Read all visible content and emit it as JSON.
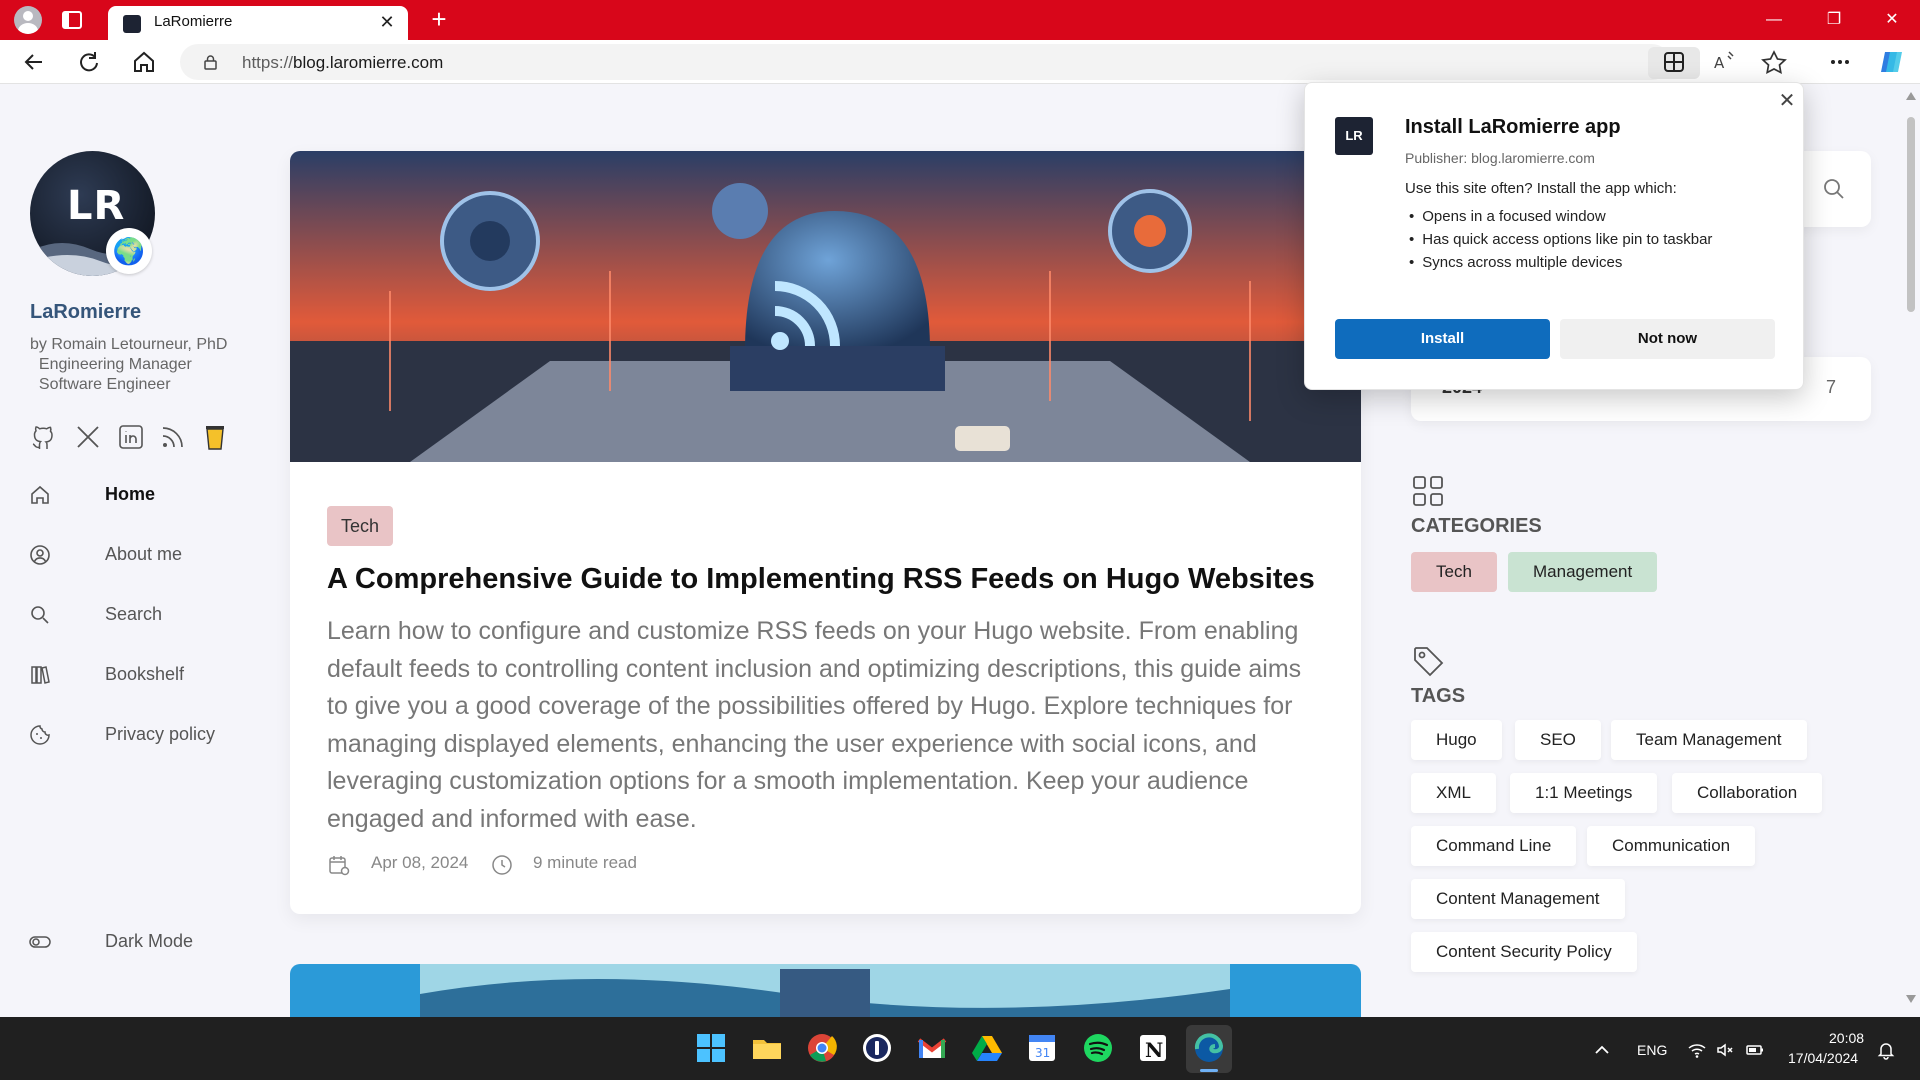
{
  "browser": {
    "tab_title": "LaRomierre",
    "url_protocol": "https://",
    "url_domain": "blog.laromierre.com"
  },
  "sidebar": {
    "avatar_mark": "LR",
    "badge_emoji": "🌍",
    "site_name": "LaRomierre",
    "bio": [
      "by Romain Letourneur, PhD",
      "  Engineering Manager",
      "  Software Engineer"
    ],
    "social_icons": [
      "github-icon",
      "x-icon",
      "linkedin-icon",
      "rss-icon",
      "coffee-icon"
    ],
    "menu": [
      {
        "label": "Home",
        "icon": "home-icon",
        "active": true
      },
      {
        "label": "About me",
        "icon": "user-circle-icon"
      },
      {
        "label": "Search",
        "icon": "search-icon"
      },
      {
        "label": "Bookshelf",
        "icon": "books-icon"
      },
      {
        "label": "Privacy policy",
        "icon": "cookie-icon"
      }
    ],
    "dark_mode_label": "Dark Mode"
  },
  "article": {
    "category": "Tech",
    "title": "A Comprehensive Guide to Implementing RSS Feeds on Hugo Websites",
    "description": "Learn how to configure and customize RSS feeds on your Hugo website. From enabling default feeds to controlling content inclusion and optimizing descriptions, this guide aims to give you a good coverage of the possibilities offered by Hugo. Explore techniques for managing displayed elements, enhancing the user experience with social icons, and leveraging customization options for a smooth implementation. Keep your audience engaged and informed with ease.",
    "date": "Apr 08, 2024",
    "read_time": "9 minute read"
  },
  "right_sidebar": {
    "archive": {
      "year": "2024",
      "count": "7"
    },
    "categories_title": "CATEGORIES",
    "categories": [
      "Tech",
      "Management"
    ],
    "tags_title": "TAGS",
    "tags": [
      "Hugo",
      "SEO",
      "Team Management",
      "XML",
      "1:1 Meetings",
      "Collaboration",
      "Command Line",
      "Communication",
      "Content Management",
      "Content Security Policy"
    ]
  },
  "install_popup": {
    "logo_mark": "LR",
    "title": "Install LaRomierre app",
    "publisher": "Publisher: blog.laromierre.com",
    "question": "Use this site often? Install the app which:",
    "bullets": [
      "Opens in a focused window",
      "Has quick access options like pin to taskbar",
      "Syncs across multiple devices"
    ],
    "install_label": "Install",
    "not_now_label": "Not now"
  },
  "taskbar": {
    "language": "ENG",
    "time": "20:08",
    "date": "17/04/2024",
    "apps": [
      "windows-start-icon",
      "file-explorer-icon",
      "chrome-icon",
      "1password-icon",
      "gmail-icon",
      "google-drive-icon",
      "google-calendar-icon",
      "spotify-icon",
      "notion-icon",
      "edge-icon"
    ]
  },
  "colors": {
    "titlebar": "#d8061a",
    "install_button": "#0f6cbd",
    "tech_chip": "#e9c4c6",
    "management_chip": "#c9e3d2"
  }
}
